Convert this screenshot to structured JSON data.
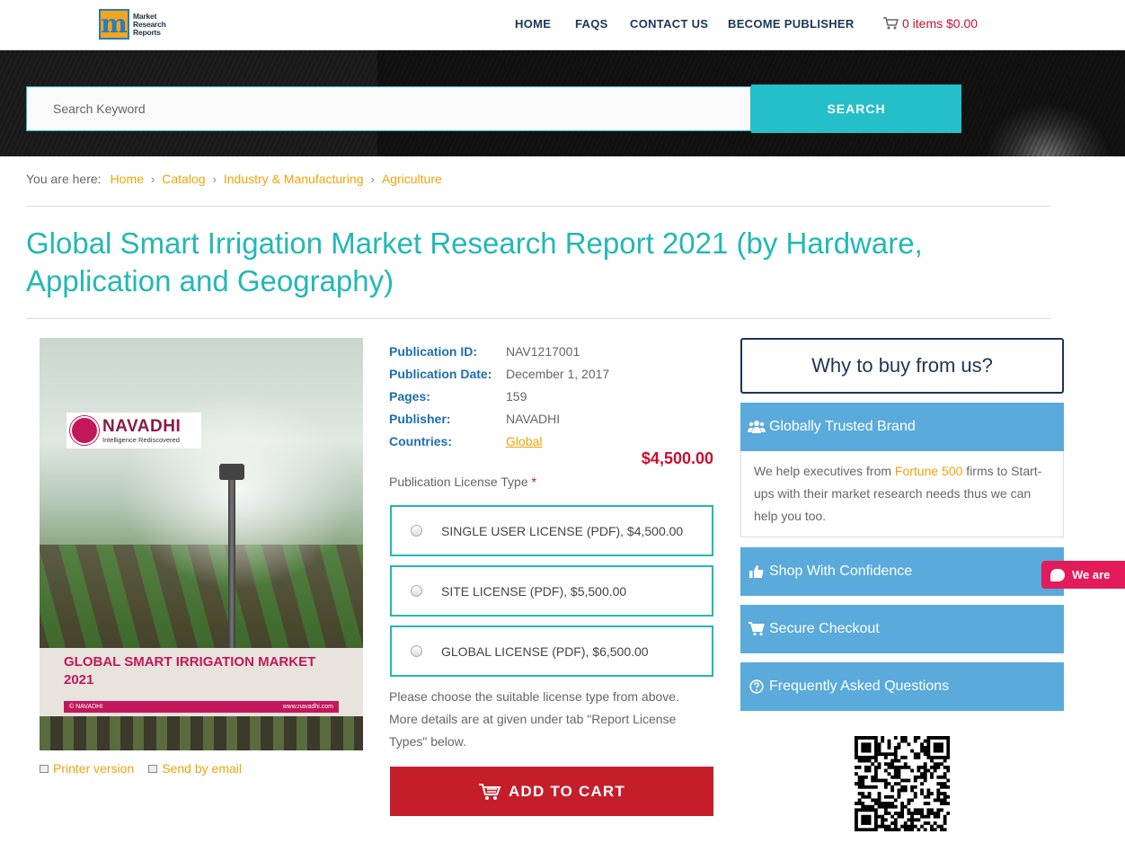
{
  "header": {
    "logo_lines": [
      "Market",
      "Research",
      "Reports"
    ],
    "nav": [
      "HOME",
      "FAQS",
      "CONTACT US",
      "BECOME PUBLISHER"
    ],
    "cart_label": "0 items $0.00"
  },
  "search": {
    "placeholder": "Search Keyword",
    "button_label": "SEARCH"
  },
  "breadcrumb": {
    "label": "You are here:",
    "items": [
      "Home",
      "Catalog",
      "Industry & Manufacturing",
      "Agriculture"
    ]
  },
  "product": {
    "title": "Global Smart Irrigation Market Research Report 2021 (by Hardware, Application and Geography)",
    "cover": {
      "brand": "NAVADHI",
      "tagline": "Intelligence Rediscovered",
      "title_line1": "GLOBAL SMART IRRIGATION MARKET",
      "title_line2": "2021",
      "strip_left": "© NAVADHI",
      "strip_right": "www.navadhi.com"
    },
    "meta": [
      {
        "key": "Publication ID:",
        "value": "NAV1217001"
      },
      {
        "key": "Publication Date:",
        "value": "December 1, 2017"
      },
      {
        "key": "Pages:",
        "value": "159"
      },
      {
        "key": "Publisher:",
        "value": "NAVADHI"
      },
      {
        "key": "Countries:",
        "value": "Global"
      }
    ],
    "price": "$4,500.00",
    "license_label": "Publication License Type",
    "license_required": "*",
    "licenses": [
      "SINGLE USER LICENSE (PDF), $4,500.00",
      "SITE LICENSE (PDF), $5,500.00",
      "GLOBAL LICENSE (PDF), $6,500.00"
    ],
    "note": "Please choose the suitable license type from above. More details are at given under tab \"Report License Types\" below.",
    "add_to_cart": "ADD TO CART",
    "printer_version": "Printer version",
    "send_by_email": "Send by email"
  },
  "sidebar": {
    "why_title": "Why to buy from us?",
    "panels": [
      {
        "label": "Globally Trusted Brand",
        "icon": "users-icon"
      },
      {
        "label": "Shop With Confidence",
        "icon": "thumbs-up-icon"
      },
      {
        "label": "Secure Checkout",
        "icon": "cart-icon"
      },
      {
        "label": "Frequently Asked Questions",
        "icon": "question-circle-icon"
      }
    ],
    "trusted_body_pre": "We help executives from ",
    "trusted_body_hl": "Fortune 500",
    "trusted_body_post": " firms to Start-ups with their market research needs thus we can help you too."
  },
  "chat": {
    "label": "We are"
  },
  "colors": {
    "teal": "#22b8b5",
    "accent_orange": "#f0a30a",
    "cart_red": "#c41e2b",
    "panel_blue": "#5aaadc",
    "navy": "#1d3557"
  }
}
